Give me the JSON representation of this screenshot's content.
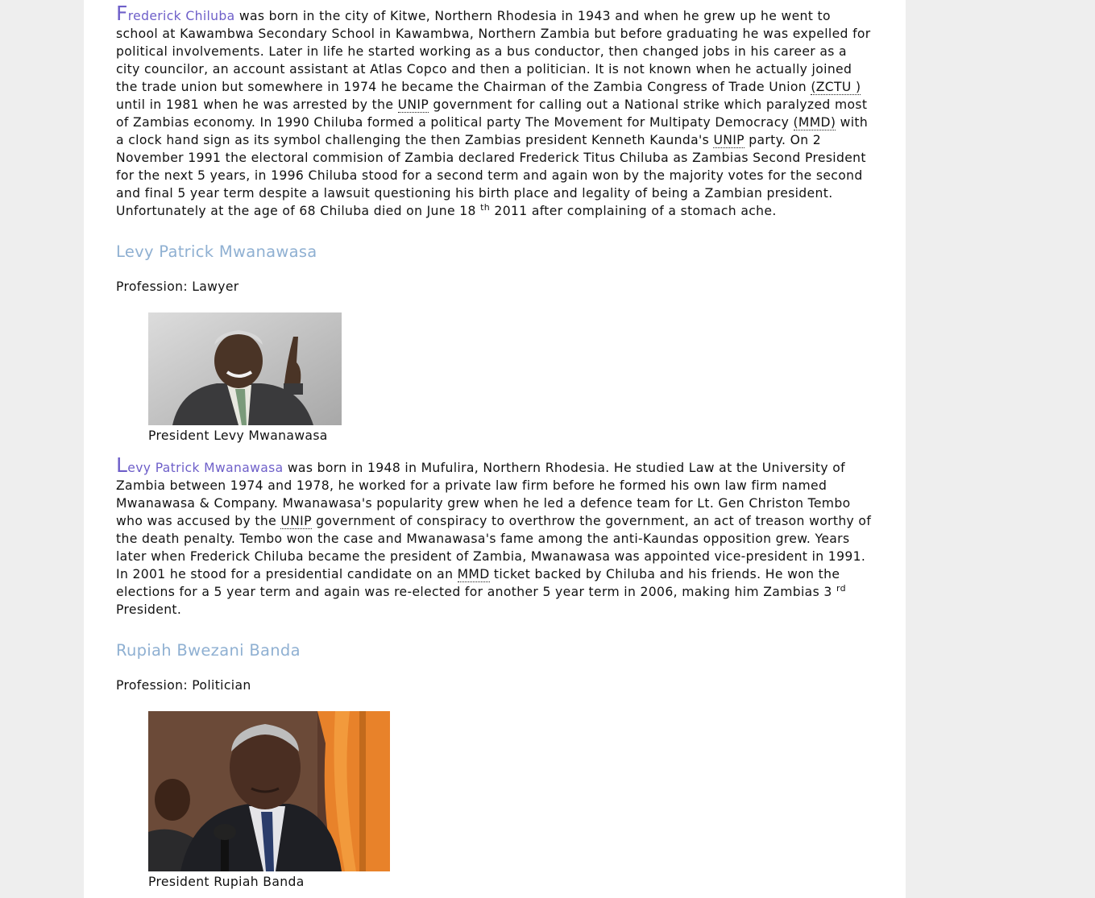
{
  "chiluba": {
    "drop": "F",
    "lead": "rederick Chiluba",
    "t1": " was born in the city of Kitwe, Northern Rhodesia in 1943 and when he grew up he went to school at Kawambwa Secondary School in Kawambwa, Northern Zambia but before graduating he was expelled for political involvements. Later in life he started working as a bus conductor, then changed jobs in his career as a city councilor, an account assistant at Atlas Copco and then a politician. It is not known when he actually joined the trade union but somewhere in 1974 he became the Chairman of the Zambia Congress of Trade Union ",
    "abbr_zctu": "(ZCTU )",
    "t2": " until in 1981 when he was arrested by the ",
    "abbr_unip1": "UNIP",
    "t3": " government for calling out a National strike which paralyzed most of Zambias economy. In 1990 Chiluba formed a political party The Movement for Multipaty Democracy ",
    "abbr_mmd": "(MMD)",
    "t4": " with a clock hand sign as its symbol challenging the then Zambias president Kenneth Kaunda's ",
    "abbr_unip2": "UNIP",
    "t5": " party. On 2 November 1991 the electoral commision of Zambia declared Frederick Titus Chiluba as Zambias Second President for the next 5 years, in 1996 Chiluba stood for a second term and again won by the majority votes for the second and final 5 year term despite a lawsuit questioning his birth place and legality of being a Zambian president. Unfortunately at the age of 68 Chiluba died on June 18 ",
    "sup": "th",
    "t6": " 2011 after complaining of a stomach ache."
  },
  "mwanawasa": {
    "heading": "Levy Patrick Mwanawasa",
    "profession": "Profession: Lawyer",
    "caption": "President Levy Mwanawasa",
    "drop": "L",
    "lead": "evy Patrick Mwanawasa",
    "t1": " was born in 1948 in Mufulira, Northern Rhodesia. He studied Law at the University of Zambia between 1974 and 1978, he worked for a private law firm before he formed his own law firm named Mwanawasa & Company. Mwanawasa's popularity grew when he led a defence team for Lt. Gen Christon Tembo who was accused by the ",
    "abbr_unip": "UNIP",
    "t2": " government of conspiracy to overthrow the government, an act of treason worthy of the death penalty. Tembo won the case and Mwanawasa's fame among the anti-Kaundas opposition grew. Years later when Frederick Chiluba became the president of Zambia, Mwanawasa was appointed vice-president in 1991. In 2001 he stood for a presidential candidate on an ",
    "abbr_mmd": "MMD",
    "t3": " ticket backed by Chiluba and his friends. He won the elections for a 5 year term and again was re-elected for another 5 year term in 2006, making him Zambias 3 ",
    "sup": "rd",
    "t4": " President."
  },
  "banda": {
    "heading": "Rupiah Bwezani Banda",
    "profession": "Profession: Politician",
    "caption": "President Rupiah Banda"
  }
}
